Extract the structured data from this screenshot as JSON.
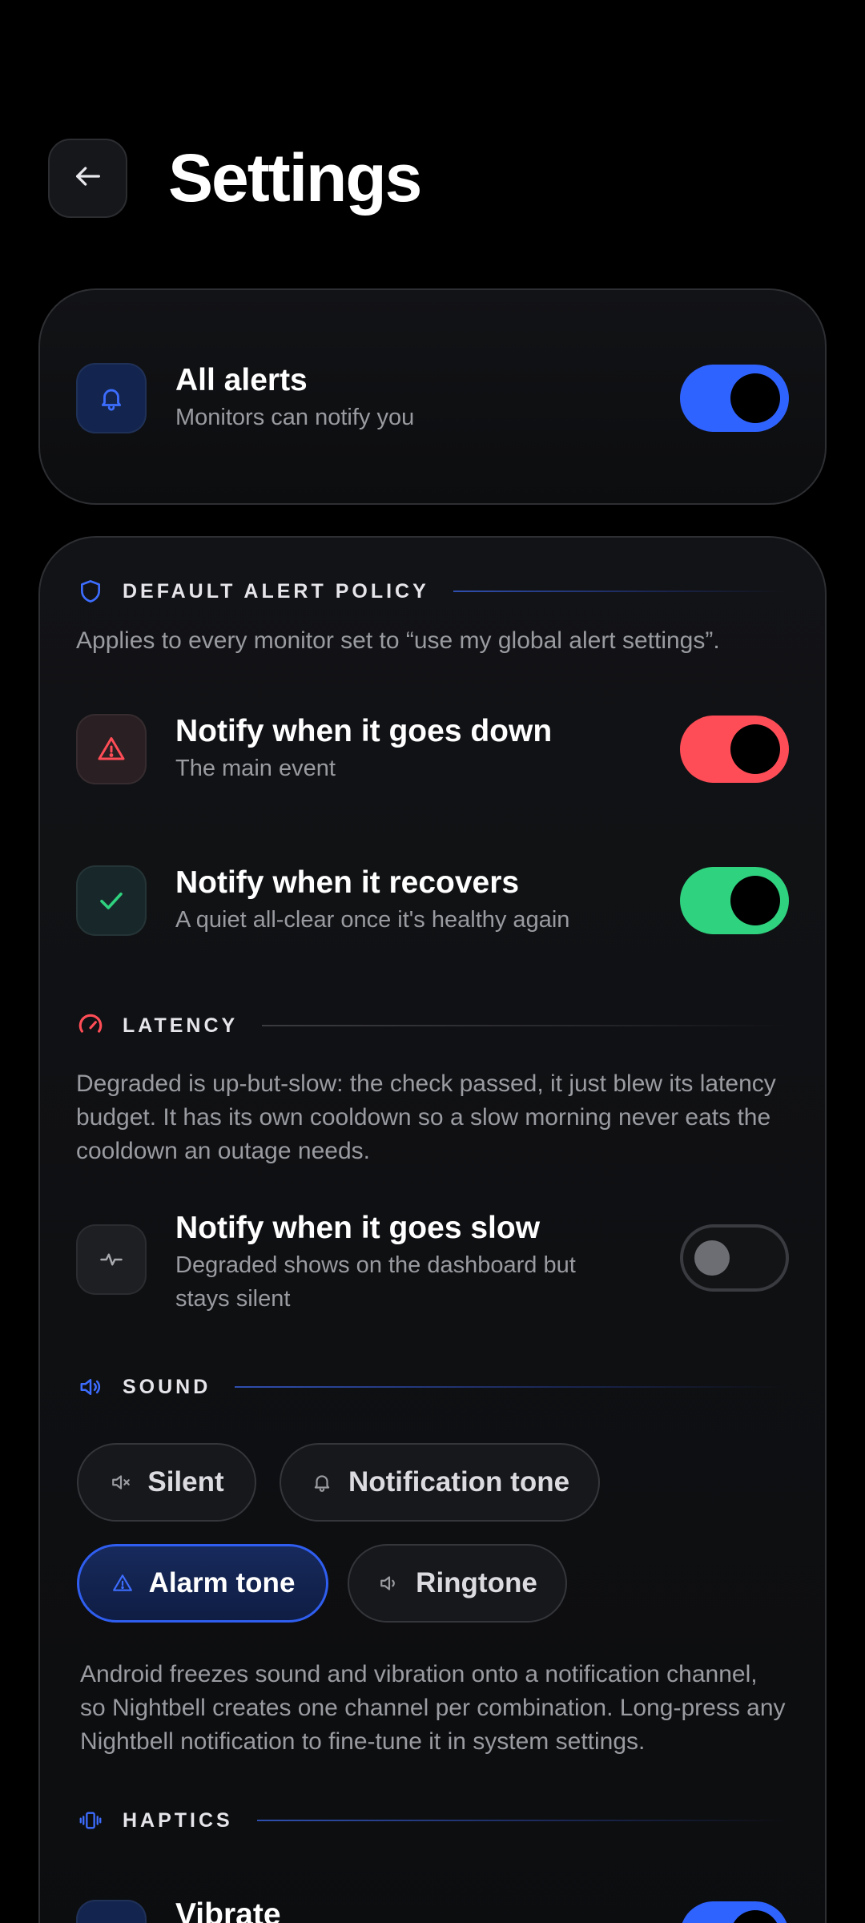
{
  "header": {
    "title": "Settings"
  },
  "all_alerts": {
    "title": "All alerts",
    "subtitle": "Monitors can notify you",
    "enabled": true
  },
  "policy": {
    "section_label": "DEFAULT ALERT POLICY",
    "description": "Applies to every monitor set to “use my global alert settings”.",
    "down": {
      "title": "Notify when it goes down",
      "subtitle": "The main event",
      "enabled": true
    },
    "recover": {
      "title": "Notify when it recovers",
      "subtitle": "A quiet all-clear once it's healthy again",
      "enabled": true
    }
  },
  "latency": {
    "section_label": "LATENCY",
    "description": "Degraded is up-but-slow: the check passed, it just blew its latency budget. It has its own cooldown so a slow morning never eats the cooldown an outage needs.",
    "slow": {
      "title": "Notify when it goes slow",
      "subtitle": "Degraded shows on the dashboard but stays silent",
      "enabled": false
    }
  },
  "sound": {
    "section_label": "SOUND",
    "options": [
      {
        "label": "Silent",
        "icon": "speaker-muted-icon",
        "selected": false
      },
      {
        "label": "Notification tone",
        "icon": "bell-icon",
        "selected": false
      },
      {
        "label": "Alarm tone",
        "icon": "warning-icon",
        "selected": true
      },
      {
        "label": "Ringtone",
        "icon": "speaker-icon",
        "selected": false
      }
    ],
    "description": "Android freezes sound and vibration onto a notification channel, so Nightbell creates one channel per combination. Long-press any Nightbell notification to fine-tune it in system settings."
  },
  "haptics": {
    "section_label": "HAPTICS",
    "vibrate": {
      "title": "Vibrate",
      "enabled": true
    }
  },
  "colors": {
    "accent_blue": "#2f63ff",
    "danger_red": "#ff4d57",
    "success_green": "#2fd27f"
  }
}
